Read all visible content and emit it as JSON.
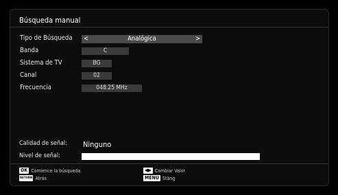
{
  "window": {
    "title": "Búsqueda manual"
  },
  "form": {
    "search_type": {
      "label": "Tipo de Búsqueda",
      "value": "Analógica",
      "left_arrow": "<",
      "right_arrow": ">"
    },
    "band": {
      "label": "Banda",
      "value": "C"
    },
    "tv_system": {
      "label": "Sistema de TV",
      "value": "BG"
    },
    "channel": {
      "label": "Canal",
      "value": "02"
    },
    "frequency": {
      "label": "Frecuencia",
      "value": "048.25 MHz"
    }
  },
  "signal": {
    "quality_label": "Calidad de señal:",
    "quality_value": "Ninguno",
    "level_label": "Nivel de señal:",
    "level_fraction": 1.0
  },
  "hints": {
    "ok_key": "OK",
    "ok_text": "Comience la búsqueda",
    "back_key": "RETURN",
    "back_text": "Atrás",
    "change_text": "Cambiar Valor",
    "menu_key": "MENU",
    "menu_text": "Stäng"
  },
  "colors": {
    "background": "#000000",
    "field": "#3a3a3a",
    "selected_field": "#4a4a4a"
  }
}
